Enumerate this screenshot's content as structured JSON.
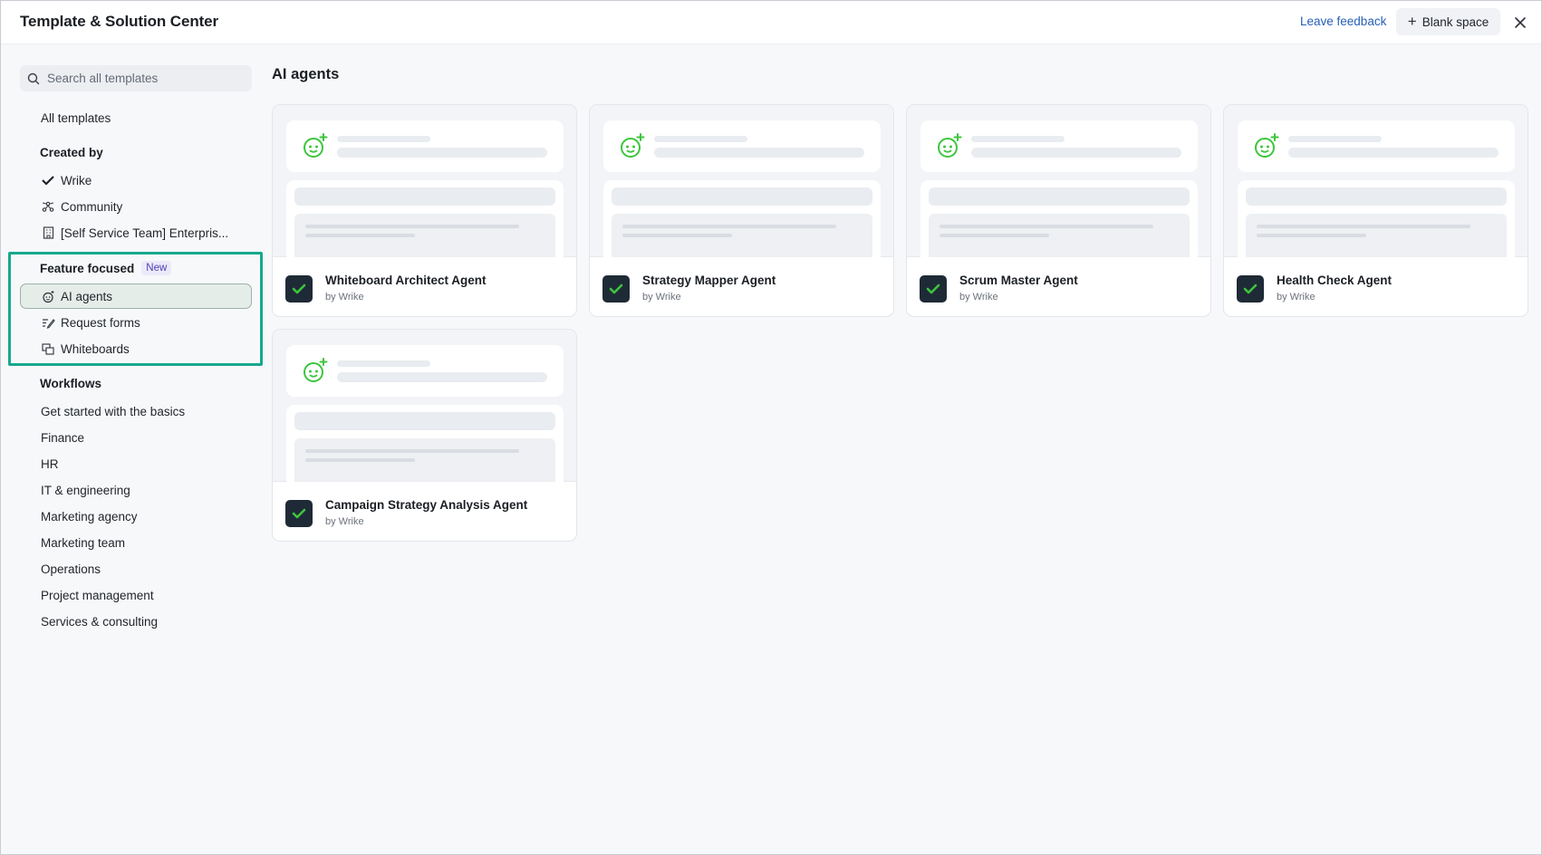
{
  "header": {
    "title": "Template & Solution Center",
    "leave_feedback": "Leave feedback",
    "blank_space": "Blank space"
  },
  "sidebar": {
    "search_placeholder": "Search all templates",
    "all_templates": "All templates",
    "created_by": {
      "heading": "Created by",
      "items": [
        "Wrike",
        "Community",
        "[Self Service Team] Enterpris..."
      ]
    },
    "feature_focused": {
      "heading": "Feature focused",
      "badge": "New",
      "items": [
        "AI agents",
        "Request forms",
        "Whiteboards"
      ],
      "selected": "AI agents"
    },
    "workflows": {
      "heading": "Workflows",
      "items": [
        "Get started with the basics",
        "Finance",
        "HR",
        "IT & engineering",
        "Marketing agency",
        "Marketing team",
        "Operations",
        "Project management",
        "Services & consulting"
      ]
    }
  },
  "main": {
    "title": "AI agents",
    "cards": [
      {
        "name": "Whiteboard Architect Agent",
        "by": "by Wrike"
      },
      {
        "name": "Strategy Mapper Agent",
        "by": "by Wrike"
      },
      {
        "name": "Scrum Master Agent",
        "by": "by Wrike"
      },
      {
        "name": "Health Check Agent",
        "by": "by Wrike"
      },
      {
        "name": "Campaign Strategy Analysis Agent",
        "by": "by Wrike"
      }
    ]
  },
  "colors": {
    "accent_highlight": "#17a88d",
    "agent_icon_green": "#3cc63c",
    "link_blue": "#2760b8",
    "logo_dark": "#1f2a37"
  }
}
